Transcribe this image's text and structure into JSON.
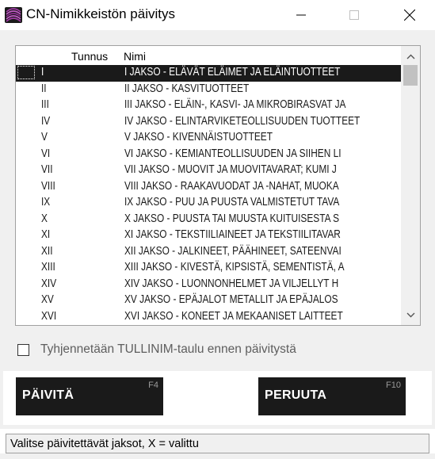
{
  "window": {
    "title": "CN-Nimikkeistön päivitys",
    "accent_color": "#8a2a8f"
  },
  "list": {
    "headers": {
      "code": "Tunnus",
      "name": "Nimi"
    },
    "selected_index": 0,
    "rows": [
      {
        "code": "I",
        "name": "I JAKSO - ELÄVÄT ELÄIMET JA ELÄINTUOTTEET"
      },
      {
        "code": "II",
        "name": "II JAKSO - KASVITUOTTEET"
      },
      {
        "code": "III",
        "name": "III JAKSO - ELÄIN-, KASVI- JA MIKROBIRASVAT JA"
      },
      {
        "code": "IV",
        "name": "IV JAKSO - ELINTARVIKETEOLLISUUDEN TUOTTEET"
      },
      {
        "code": "V",
        "name": "V JAKSO - KIVENNÄISTUOTTEET"
      },
      {
        "code": "VI",
        "name": "VI JAKSO - KEMIANTEOLLISUUDEN JA SIIHEN LI"
      },
      {
        "code": "VII",
        "name": "VII JAKSO - MUOVIT JA MUOVITAVARAT; KUMI J"
      },
      {
        "code": "VIII",
        "name": "VIII JAKSO - RAAKAVUODAT JA -NAHAT, MUOKA"
      },
      {
        "code": "IX",
        "name": "IX JAKSO - PUU JA PUUSTA VALMISTETUT TAVA"
      },
      {
        "code": "X",
        "name": "X JAKSO - PUUSTA TAI MUUSTA KUITUISESTA S"
      },
      {
        "code": "XI",
        "name": "XI JAKSO - TEKSTIILIAINEET JA TEKSTIILITAVAR"
      },
      {
        "code": "XII",
        "name": "XII JAKSO - JALKINEET, PÄÄHINEET, SATEENVAI"
      },
      {
        "code": "XIII",
        "name": "XIII JAKSO - KIVESTÄ, KIPSISTÄ, SEMENTISTÄ, A"
      },
      {
        "code": "XIV",
        "name": "XIV JAKSO - LUONNONHELMET JA VILJELLYT H"
      },
      {
        "code": "XV",
        "name": "XV JAKSO - EPÄJALOT METALLIT JA EPÄJALOS"
      },
      {
        "code": "XVI",
        "name": "XVI JAKSO - KONEET JA MEKAANISET LAITTEET"
      }
    ]
  },
  "checkbox": {
    "label": "Tyhjennetään TULLINIM-taulu ennen päivitystä",
    "checked": false
  },
  "buttons": {
    "update": {
      "label": "PÄIVITÄ",
      "shortcut": "F4"
    },
    "cancel": {
      "label": "PERUUTA",
      "shortcut": "F10"
    }
  },
  "status": {
    "text": "Valitse päivitettävät jaksot, X = valittu"
  }
}
